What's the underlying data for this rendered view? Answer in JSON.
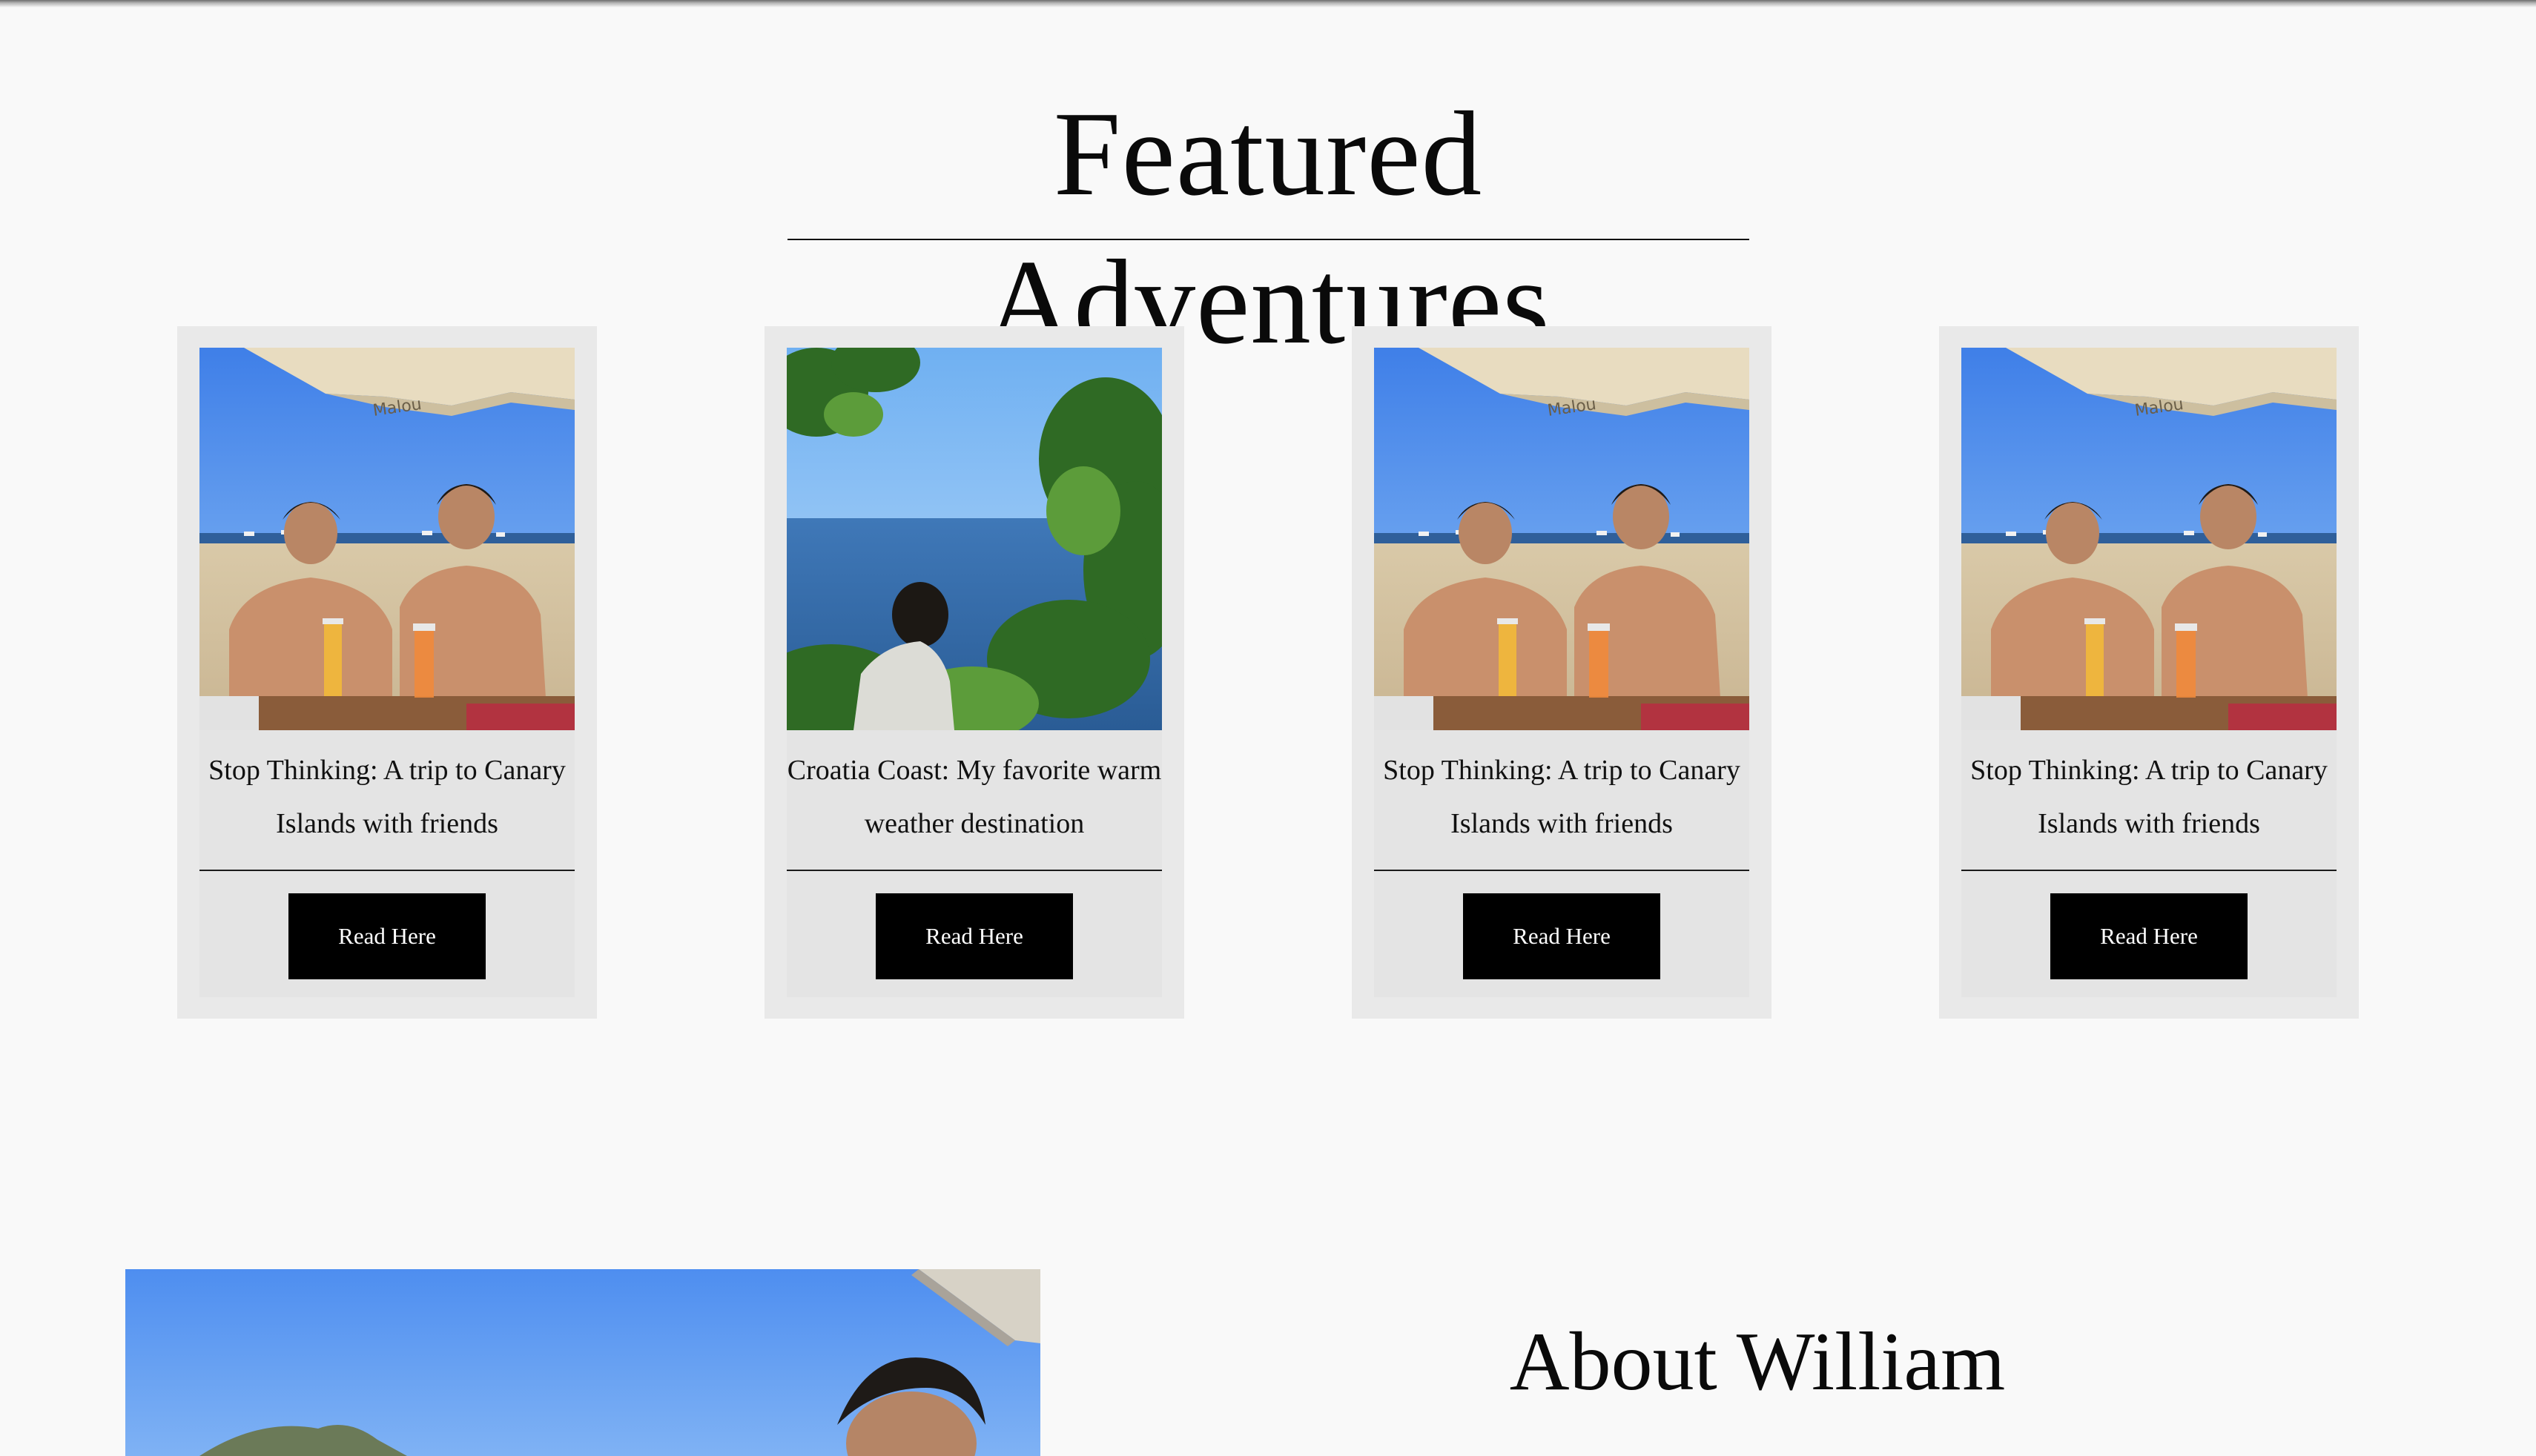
{
  "featured": {
    "title": "Featured Adventures",
    "cards": [
      {
        "title": "Stop Thinking: A trip to Canary Islands with friends",
        "button_label": "Read Here",
        "photo": "beach-friends-photo"
      },
      {
        "title": "Croatia Coast: My favorite warm weather destination",
        "button_label": "Read Here",
        "photo": "croatia-coast-photo"
      },
      {
        "title": "Stop Thinking: A trip to Canary Islands with friends",
        "button_label": "Read Here",
        "photo": "beach-friends-photo"
      },
      {
        "title": "Stop Thinking: A trip to Canary Islands with friends",
        "button_label": "Read Here",
        "photo": "beach-friends-photo"
      }
    ]
  },
  "about": {
    "title": "About William",
    "photo": "william-portrait-photo"
  },
  "colors": {
    "background": "#f9f9f9",
    "card": "#e9e9e9",
    "button": "#000000",
    "button_text": "#ffffff"
  }
}
